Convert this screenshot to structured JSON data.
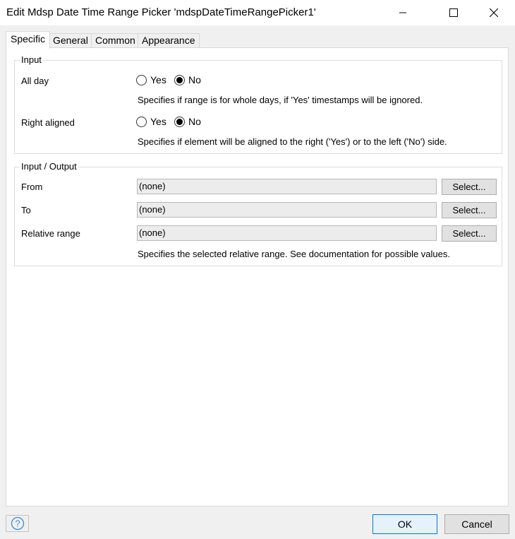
{
  "window": {
    "title": "Edit Mdsp Date Time Range Picker 'mdspDateTimeRangePicker1'"
  },
  "tabs": [
    {
      "label": "Specific"
    },
    {
      "label": "General"
    },
    {
      "label": "Common"
    },
    {
      "label": "Appearance"
    }
  ],
  "input_group": {
    "title": "Input",
    "all_day": {
      "label": "All day",
      "yes": "Yes",
      "no": "No",
      "selected": "No",
      "help": "Specifies if range is for whole days, if 'Yes' timestamps will be ignored."
    },
    "right_aligned": {
      "label": "Right aligned",
      "yes": "Yes",
      "no": "No",
      "selected": "No",
      "help": "Specifies if element will be aligned to the right ('Yes') or to the left ('No') side."
    }
  },
  "io_group": {
    "title": "Input / Output",
    "from": {
      "label": "From",
      "value": "(none)",
      "button": "Select..."
    },
    "to": {
      "label": "To",
      "value": "(none)",
      "button": "Select..."
    },
    "relative_range": {
      "label": "Relative range",
      "value": "(none)",
      "button": "Select...",
      "help": "Specifies the selected relative range.  See documentation for possible values."
    }
  },
  "footer": {
    "ok": "OK",
    "cancel": "Cancel",
    "help_icon": "question-mark-icon"
  },
  "colors": {
    "accent": "#0078d7",
    "help_icon": "#3c8dd0"
  }
}
